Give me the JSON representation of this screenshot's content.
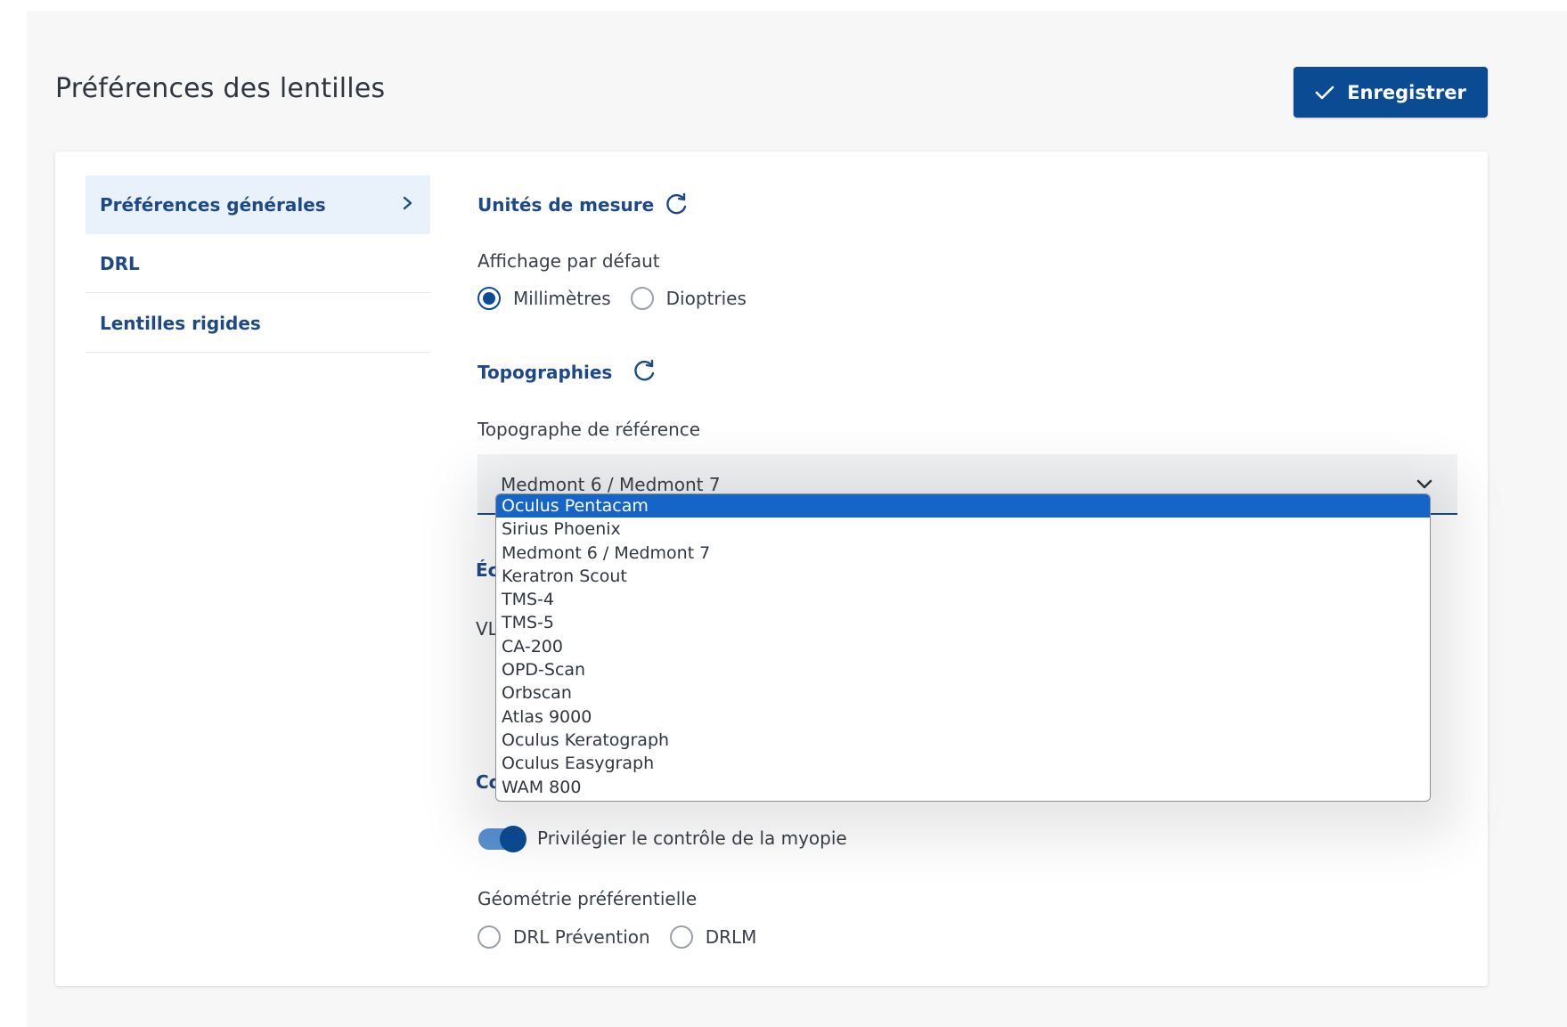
{
  "header": {
    "title": "Préférences des lentilles",
    "save_label": "Enregistrer"
  },
  "sidebar": {
    "items": [
      {
        "label": "Préférences générales",
        "active": true
      },
      {
        "label": "DRL",
        "active": false
      },
      {
        "label": "Lentilles rigides",
        "active": false
      }
    ]
  },
  "units": {
    "title": "Unités de mesure",
    "default_display_label": "Affichage par défaut",
    "options": [
      {
        "label": "Millimètres",
        "checked": true
      },
      {
        "label": "Dioptries",
        "checked": false
      }
    ]
  },
  "topographies": {
    "title": "Topographies",
    "reference_label": "Topographe de référence",
    "selected_value": "Medmont 6 / Medmont 7",
    "dropdown_options": [
      "Oculus Pentacam",
      "Sirius Phoenix",
      "Medmont 6 / Medmont 7",
      "Keratron Scout",
      "TMS-4",
      "TMS-5",
      "CA-200",
      "OPD-Scan",
      "Orbscan",
      "Atlas 9000",
      "Oculus Keratograph",
      "Oculus Easygraph",
      "WAM 800"
    ],
    "highlighted_option": "Oculus Pentacam"
  },
  "partially_hidden": {
    "section1_fragment": "Éc",
    "field_fragment": "VL",
    "section2_fragment": "Co"
  },
  "myopia": {
    "toggle_label": "Privilégier le contrôle de la myopie",
    "toggle_on": true
  },
  "geometry": {
    "label": "Géométrie préférentielle",
    "options": [
      {
        "label": "DRL Prévention",
        "checked": false
      },
      {
        "label": "DRLM",
        "checked": false
      }
    ]
  },
  "colors": {
    "primary": "#0b4b94",
    "link": "#1d4a86",
    "highlight": "#1565c8",
    "active_sidebar_bg": "#e9f1fa"
  }
}
